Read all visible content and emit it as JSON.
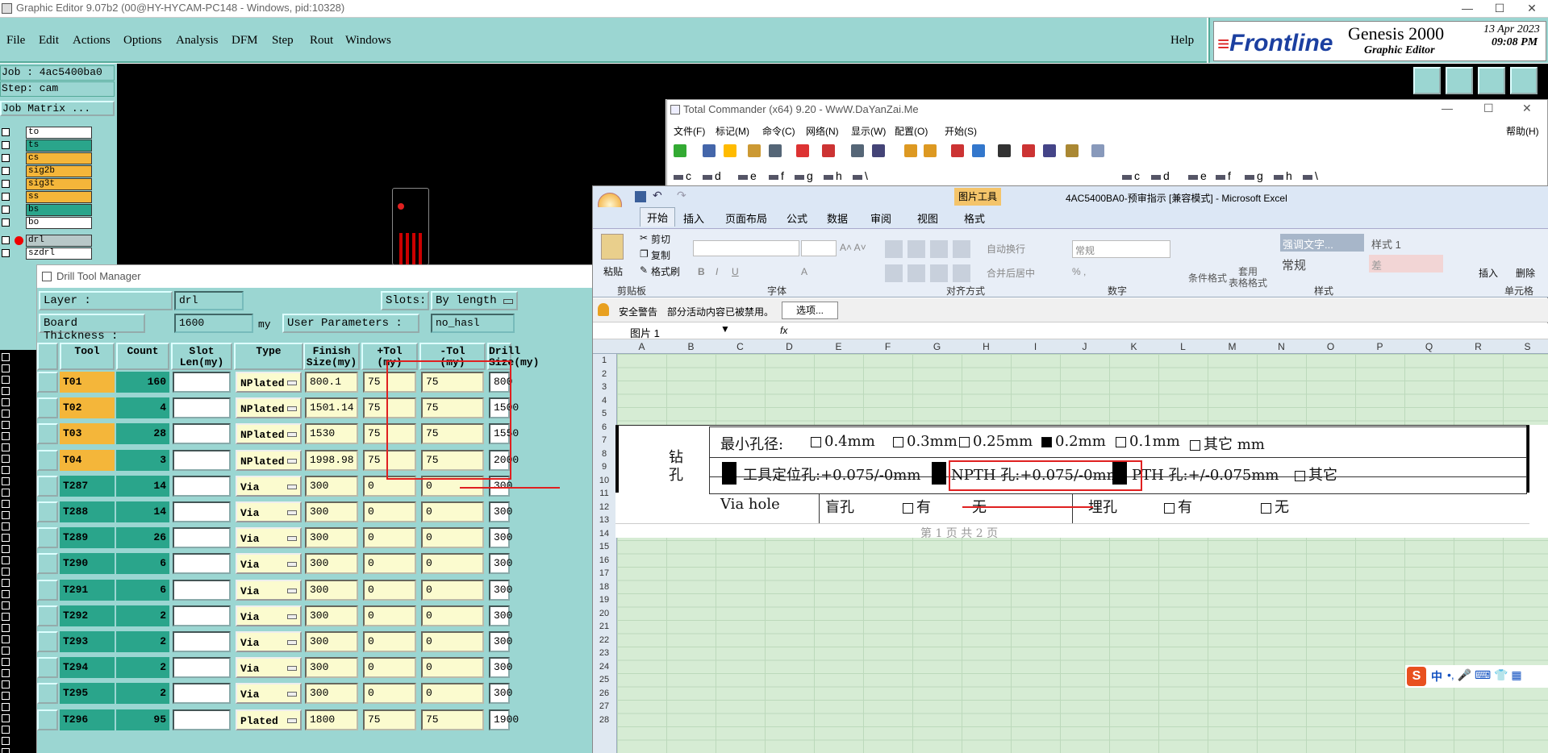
{
  "genesis": {
    "title": "Graphic Editor 9.07b2 (00@HY-HYCAM-PC148 - Windows, pid:10328)",
    "menu": [
      "File",
      "Edit",
      "Actions",
      "Options",
      "Analysis",
      "DFM",
      "Step",
      "Rout",
      "Windows"
    ],
    "help": "Help",
    "brand": "Frontline",
    "product": "Genesis 2000",
    "subtitle": "Graphic Editor",
    "date": "13 Apr 2023",
    "time": "09:08 PM",
    "job_line": "Job : 4ac5400ba0",
    "step_line": "Step: cam",
    "job_matrix": "Job Matrix ...",
    "layers": [
      {
        "name": "to",
        "color": "#ffffff"
      },
      {
        "name": "ts",
        "color": "#2aa58b"
      },
      {
        "name": "cs",
        "color": "#f4b63a"
      },
      {
        "name": "sig2b",
        "color": "#f4b63a"
      },
      {
        "name": "sig3t",
        "color": "#f4b63a"
      },
      {
        "name": "ss",
        "color": "#f4b63a"
      },
      {
        "name": "bs",
        "color": "#2aa58b"
      },
      {
        "name": "bo",
        "color": "#ffffff"
      },
      {
        "name": "drl",
        "color": "#b8c8c8"
      },
      {
        "name": "szdrl",
        "color": "#ffffff"
      }
    ]
  },
  "dtm": {
    "title": "Drill Tool Manager",
    "layer_label": "Layer :",
    "layer_value": "drl",
    "slots_label": "Slots:",
    "slots_value": "By length",
    "thick_label": "Board Thickness :",
    "thick_value": "1600",
    "thick_unit": "my",
    "userparam_label": "User Parameters :",
    "userparam_value": "no_hasl",
    "headers": [
      "Tool",
      "Count",
      "Slot\nLen(my)",
      "Type",
      "Finish\nSize(my)",
      "+Tol\n(my)",
      "-Tol\n(my)",
      "Drill\nSize(my)"
    ],
    "rows": [
      {
        "tool": "T01",
        "count": "160",
        "type": "NPlated",
        "finish": "800.1",
        "ptol": "75",
        "ntol": "75",
        "drill": "800"
      },
      {
        "tool": "T02",
        "count": "4",
        "type": "NPlated",
        "finish": "1501.14",
        "ptol": "75",
        "ntol": "75",
        "drill": "1500"
      },
      {
        "tool": "T03",
        "count": "28",
        "type": "NPlated",
        "finish": "1530",
        "ptol": "75",
        "ntol": "75",
        "drill": "1550"
      },
      {
        "tool": "T04",
        "count": "3",
        "type": "NPlated",
        "finish": "1998.98",
        "ptol": "75",
        "ntol": "75",
        "drill": "2000"
      },
      {
        "tool": "T287",
        "count": "14",
        "type": "Via",
        "finish": "300",
        "ptol": "0",
        "ntol": "0",
        "drill": "300"
      },
      {
        "tool": "T288",
        "count": "14",
        "type": "Via",
        "finish": "300",
        "ptol": "0",
        "ntol": "0",
        "drill": "300"
      },
      {
        "tool": "T289",
        "count": "26",
        "type": "Via",
        "finish": "300",
        "ptol": "0",
        "ntol": "0",
        "drill": "300"
      },
      {
        "tool": "T290",
        "count": "6",
        "type": "Via",
        "finish": "300",
        "ptol": "0",
        "ntol": "0",
        "drill": "300"
      },
      {
        "tool": "T291",
        "count": "6",
        "type": "Via",
        "finish": "300",
        "ptol": "0",
        "ntol": "0",
        "drill": "300"
      },
      {
        "tool": "T292",
        "count": "2",
        "type": "Via",
        "finish": "300",
        "ptol": "0",
        "ntol": "0",
        "drill": "300"
      },
      {
        "tool": "T293",
        "count": "2",
        "type": "Via",
        "finish": "300",
        "ptol": "0",
        "ntol": "0",
        "drill": "300"
      },
      {
        "tool": "T294",
        "count": "2",
        "type": "Via",
        "finish": "300",
        "ptol": "0",
        "ntol": "0",
        "drill": "300"
      },
      {
        "tool": "T295",
        "count": "2",
        "type": "Via",
        "finish": "300",
        "ptol": "0",
        "ntol": "0",
        "drill": "300"
      },
      {
        "tool": "T296",
        "count": "95",
        "type": "Plated",
        "finish": "1800",
        "ptol": "75",
        "ntol": "75",
        "drill": "1900"
      }
    ]
  },
  "tc": {
    "title": "Total Commander (x64) 9.20 - WwW.DaYanZai.Me",
    "menu": [
      "文件(F)",
      "标记(M)",
      "命令(C)",
      "网络(N)",
      "显示(W)",
      "配置(O)",
      "开始(S)"
    ],
    "help": "帮助(H)",
    "drives": [
      "c",
      "d",
      "e",
      "f",
      "g",
      "h",
      "\\"
    ]
  },
  "excel": {
    "title": "4AC5400BA0-预审指示 [兼容模式] - Microsoft Excel",
    "contextual_tab": "图片工具",
    "tabs": [
      "开始",
      "插入",
      "页面布局",
      "公式",
      "数据",
      "审阅",
      "视图",
      "格式"
    ],
    "clipboard": {
      "paste": "粘贴",
      "cut": "剪切",
      "copy": "复制",
      "painter": "格式刷",
      "label": "剪贴板"
    },
    "groups": {
      "font": "字体",
      "align": "对齐方式",
      "number": "数字",
      "styles": "样式",
      "cells": "单元格"
    },
    "align_btns": {
      "wrap": "自动换行",
      "merge": "合并后居中"
    },
    "number_fmt": "常规",
    "styles_btns": {
      "cond": "条件格式",
      "table1": "套用",
      "table2": "表格格式",
      "s1": "强调文字...",
      "s2": "样式 1",
      "s3": "常规",
      "s4": "差"
    },
    "cells_btns": {
      "insert": "插入",
      "delete": "删除"
    },
    "security_label": "安全警告",
    "security_msg": "部分活动内容已被禁用。",
    "options_btn": "选项...",
    "namebox": "图片 1",
    "fx": "fx",
    "cols": [
      "A",
      "B",
      "C",
      "D",
      "E",
      "F",
      "G",
      "H",
      "I",
      "J",
      "K",
      "L",
      "M",
      "N",
      "O",
      "P",
      "Q",
      "R",
      "S"
    ],
    "rows": [
      "1",
      "2",
      "3",
      "4",
      "5",
      "6",
      "7",
      "8",
      "9",
      "10",
      "11",
      "12",
      "13",
      "14",
      "15",
      "16",
      "17",
      "18",
      "19",
      "20",
      "21",
      "22",
      "23",
      "24",
      "25",
      "26",
      "27",
      "28"
    ]
  },
  "doc": {
    "drill": "钻\n孔",
    "min_hole": "最小孔径:",
    "opt1": "0.4mm",
    "opt2": "0.3mm",
    "opt3": "0.25mm",
    "opt4": "0.2mm",
    "opt5": "0.1mm",
    "opt6": "其它 mm",
    "tool_hole": "工具定位孔:+0.075/-0mm",
    "npth": "NPTH 孔:+0.075/-0mm",
    "pth": "PTH 孔:+/-0.075mm",
    "other": "其它",
    "via": "Via hole",
    "blind": "盲孔",
    "yes": "有",
    "no": "无",
    "buried": "埋孔",
    "page": "第 1 页 共 2 页"
  },
  "ime": {
    "lang": "中"
  },
  "colors": {
    "teal": "#9bd6d2",
    "dark_teal": "#2aa58b",
    "orange": "#f4b63a",
    "red_annot": "#e02020"
  }
}
